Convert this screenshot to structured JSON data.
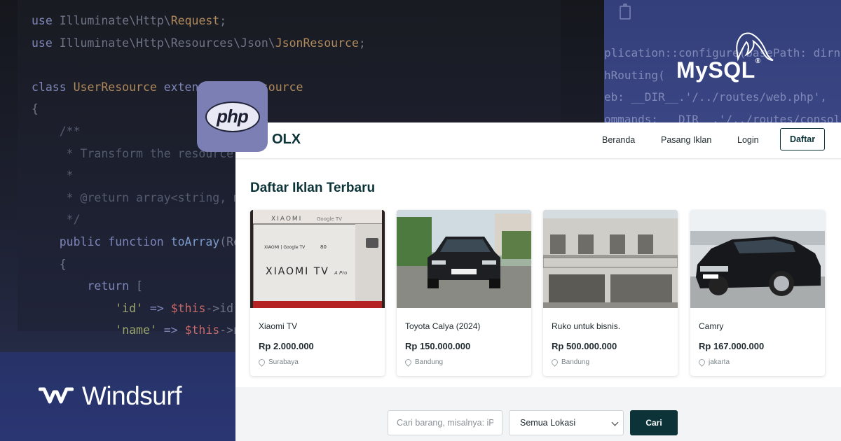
{
  "code_left": {
    "lines": [
      [
        {
          "t": "use ",
          "c": "k"
        },
        {
          "t": "Illuminate\\Http\\",
          "c": ""
        },
        {
          "t": "Request",
          "c": "cls"
        },
        {
          "t": ";",
          "c": ""
        }
      ],
      [
        {
          "t": "use ",
          "c": "k"
        },
        {
          "t": "Illuminate\\Http\\Resources\\Json\\",
          "c": ""
        },
        {
          "t": "JsonResource",
          "c": "cls"
        },
        {
          "t": ";",
          "c": ""
        }
      ],
      [],
      [
        {
          "t": "class ",
          "c": "k"
        },
        {
          "t": "UserResource ",
          "c": "cls"
        },
        {
          "t": "extends ",
          "c": "k"
        },
        {
          "t": "JsonResource",
          "c": "cls"
        }
      ],
      [
        {
          "t": "{",
          "c": ""
        }
      ],
      [
        {
          "t": "    /**",
          "c": "cm"
        }
      ],
      [
        {
          "t": "     * Transform the resource into an array.",
          "c": "cm"
        }
      ],
      [
        {
          "t": "     *",
          "c": "cm"
        }
      ],
      [
        {
          "t": "     * @return array<string, mixed>",
          "c": "cm"
        }
      ],
      [
        {
          "t": "     */",
          "c": "cm"
        }
      ],
      [
        {
          "t": "    public function ",
          "c": "k"
        },
        {
          "t": "toArray",
          "c": "fn"
        },
        {
          "t": "(Request $request): array",
          "c": ""
        }
      ],
      [
        {
          "t": "    {",
          "c": ""
        }
      ],
      [
        {
          "t": "        return ",
          "c": "k"
        },
        {
          "t": "[",
          "c": ""
        }
      ],
      [
        {
          "t": "            'id' ",
          "c": "str"
        },
        {
          "t": "=> ",
          "c": "k"
        },
        {
          "t": "$this",
          "c": "var"
        },
        {
          "t": "->id,",
          "c": ""
        }
      ],
      [
        {
          "t": "            'name' ",
          "c": "str"
        },
        {
          "t": "=> ",
          "c": "k"
        },
        {
          "t": "$this",
          "c": "var"
        },
        {
          "t": "->name,",
          "c": ""
        }
      ]
    ]
  },
  "code_right": {
    "lines": [
      "plication::configure(basePath: dirname(__DIR__))",
      "hRouting(",
      "eb: __DIR__.'/../routes/web.php',",
      "ommands: __DIR__.'/../routes/console.php',"
    ]
  },
  "logos": {
    "php": "php",
    "mysql_my": "My",
    "mysql_sql": "SQL",
    "windsurf": "Windsurf"
  },
  "app": {
    "brand": "OLX",
    "nav": {
      "home": "Beranda",
      "post_ad": "Pasang Iklan",
      "login": "Login",
      "register": "Daftar"
    },
    "section_title": "Daftar Iklan Terbaru",
    "listings": [
      {
        "title": "Xiaomi TV",
        "price": "Rp 2.000.000",
        "location": "Surabaya"
      },
      {
        "title": "Toyota Calya (2024)",
        "price": "Rp 150.000.000",
        "location": "Bandung"
      },
      {
        "title": "Ruko untuk bisnis.",
        "price": "Rp 500.000.000",
        "location": "Bandung"
      },
      {
        "title": "Camry",
        "price": "Rp 167.000.000",
        "location": "jakarta"
      }
    ],
    "search": {
      "placeholder": "Cari barang, misalnya: iPhone",
      "location_selected": "Semua Lokasi",
      "button": "Cari"
    }
  },
  "colors": {
    "brand_dark": "#0b3338",
    "php_badge": "#7b7fb4",
    "page_bg": "#27336b"
  }
}
